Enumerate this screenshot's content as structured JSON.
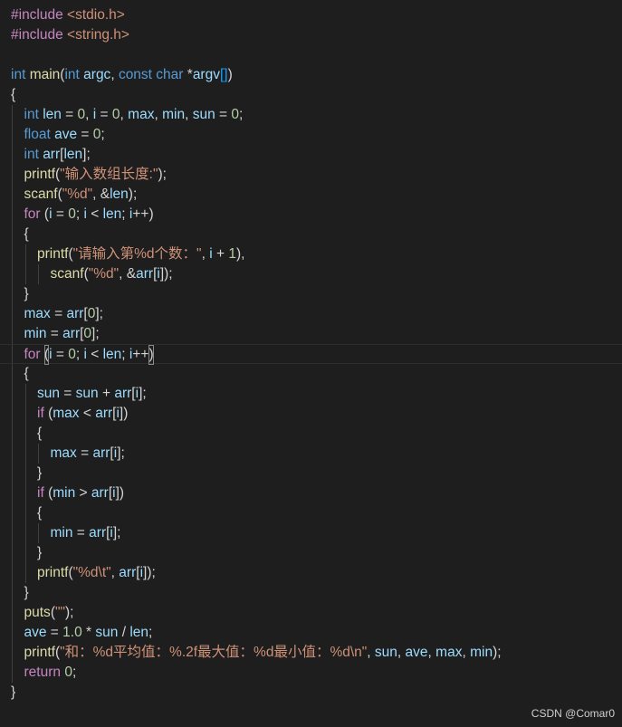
{
  "top_clip_text": "                  ... (",
  "watermark": "CSDN @Comar0",
  "colors": {
    "background": "#1e1e1e",
    "preprocessor": "#c586c0",
    "string": "#ce9178",
    "keyword": "#569cd6",
    "control": "#c586c0",
    "function": "#dcdcaa",
    "variable": "#9cdcfe",
    "number": "#b5cea8"
  },
  "lines": [
    {
      "indent": 0,
      "tokens": [
        [
          "pp",
          "#include "
        ],
        [
          "str",
          "<stdio.h>"
        ]
      ]
    },
    {
      "indent": 0,
      "tokens": [
        [
          "pp",
          "#include "
        ],
        [
          "str",
          "<string.h>"
        ]
      ]
    },
    {
      "indent": 0,
      "tokens": []
    },
    {
      "indent": 0,
      "tokens": [
        [
          "kw",
          "int "
        ],
        [
          "fn",
          "main"
        ],
        [
          "pun",
          "("
        ],
        [
          "kw",
          "int "
        ],
        [
          "var",
          "argc"
        ],
        [
          "pun",
          ", "
        ],
        [
          "kw",
          "const "
        ],
        [
          "kw",
          "char "
        ],
        [
          "pun",
          "*"
        ],
        [
          "var",
          "argv"
        ],
        [
          "brk3",
          "[]"
        ],
        [
          "pun",
          ")"
        ]
      ]
    },
    {
      "indent": 0,
      "tokens": [
        [
          "pun",
          "{"
        ]
      ]
    },
    {
      "indent": 1,
      "tokens": [
        [
          "kw",
          "int "
        ],
        [
          "var",
          "len"
        ],
        [
          "pun",
          " = "
        ],
        [
          "num",
          "0"
        ],
        [
          "pun",
          ", "
        ],
        [
          "var",
          "i"
        ],
        [
          "pun",
          " = "
        ],
        [
          "num",
          "0"
        ],
        [
          "pun",
          ", "
        ],
        [
          "var",
          "max"
        ],
        [
          "pun",
          ", "
        ],
        [
          "var",
          "min"
        ],
        [
          "pun",
          ", "
        ],
        [
          "var",
          "sun"
        ],
        [
          "pun",
          " = "
        ],
        [
          "num",
          "0"
        ],
        [
          "pun",
          ";"
        ]
      ]
    },
    {
      "indent": 1,
      "tokens": [
        [
          "kw",
          "float "
        ],
        [
          "var",
          "ave"
        ],
        [
          "pun",
          " = "
        ],
        [
          "num",
          "0"
        ],
        [
          "pun",
          ";"
        ]
      ]
    },
    {
      "indent": 1,
      "tokens": [
        [
          "kw",
          "int "
        ],
        [
          "var",
          "arr"
        ],
        [
          "pun",
          "["
        ],
        [
          "var",
          "len"
        ],
        [
          "pun",
          "];"
        ]
      ]
    },
    {
      "indent": 1,
      "tokens": [
        [
          "fn",
          "printf"
        ],
        [
          "pun",
          "("
        ],
        [
          "str",
          "\"输入数组长度:\""
        ],
        [
          "pun",
          ");"
        ]
      ]
    },
    {
      "indent": 1,
      "tokens": [
        [
          "fn",
          "scanf"
        ],
        [
          "pun",
          "("
        ],
        [
          "str",
          "\"%d\""
        ],
        [
          "pun",
          ", &"
        ],
        [
          "var",
          "len"
        ],
        [
          "pun",
          ");"
        ]
      ]
    },
    {
      "indent": 1,
      "tokens": [
        [
          "ctl",
          "for "
        ],
        [
          "pun",
          "("
        ],
        [
          "var",
          "i"
        ],
        [
          "pun",
          " = "
        ],
        [
          "num",
          "0"
        ],
        [
          "pun",
          "; "
        ],
        [
          "var",
          "i"
        ],
        [
          "pun",
          " < "
        ],
        [
          "var",
          "len"
        ],
        [
          "pun",
          "; "
        ],
        [
          "var",
          "i"
        ],
        [
          "pun",
          "++)"
        ]
      ]
    },
    {
      "indent": 1,
      "tokens": [
        [
          "pun",
          "{"
        ]
      ]
    },
    {
      "indent": 2,
      "tokens": [
        [
          "fn",
          "printf"
        ],
        [
          "pun",
          "("
        ],
        [
          "str",
          "\"请输入第%d个数：\""
        ],
        [
          "pun",
          ", "
        ],
        [
          "var",
          "i"
        ],
        [
          "pun",
          " + "
        ],
        [
          "num",
          "1"
        ],
        [
          "pun",
          "),"
        ]
      ]
    },
    {
      "indent": 3,
      "tokens": [
        [
          "fn",
          "scanf"
        ],
        [
          "pun",
          "("
        ],
        [
          "str",
          "\"%d\""
        ],
        [
          "pun",
          ", &"
        ],
        [
          "var",
          "arr"
        ],
        [
          "pun",
          "["
        ],
        [
          "var",
          "i"
        ],
        [
          "pun",
          "]);"
        ]
      ]
    },
    {
      "indent": 1,
      "tokens": [
        [
          "pun",
          "}"
        ]
      ]
    },
    {
      "indent": 1,
      "tokens": [
        [
          "var",
          "max"
        ],
        [
          "pun",
          " = "
        ],
        [
          "var",
          "arr"
        ],
        [
          "pun",
          "["
        ],
        [
          "num",
          "0"
        ],
        [
          "pun",
          "];"
        ]
      ]
    },
    {
      "indent": 1,
      "tokens": [
        [
          "var",
          "min"
        ],
        [
          "pun",
          " = "
        ],
        [
          "var",
          "arr"
        ],
        [
          "pun",
          "["
        ],
        [
          "num",
          "0"
        ],
        [
          "pun",
          "];"
        ]
      ]
    },
    {
      "indent": 1,
      "current": true,
      "tokens": [
        [
          "ctl",
          "for "
        ],
        [
          "pun",
          "("
        ],
        [
          "var",
          "i"
        ],
        [
          "pun",
          " = "
        ],
        [
          "num",
          "0"
        ],
        [
          "pun",
          "; "
        ],
        [
          "var",
          "i"
        ],
        [
          "pun",
          " < "
        ],
        [
          "var",
          "len"
        ],
        [
          "pun",
          "; "
        ],
        [
          "var",
          "i"
        ],
        [
          "pun",
          "++"
        ],
        [
          "pun",
          ")"
        ]
      ]
    },
    {
      "indent": 1,
      "tokens": [
        [
          "pun",
          "{"
        ]
      ]
    },
    {
      "indent": 2,
      "tokens": [
        [
          "var",
          "sun"
        ],
        [
          "pun",
          " = "
        ],
        [
          "var",
          "sun"
        ],
        [
          "pun",
          " + "
        ],
        [
          "var",
          "arr"
        ],
        [
          "pun",
          "["
        ],
        [
          "var",
          "i"
        ],
        [
          "pun",
          "];"
        ]
      ]
    },
    {
      "indent": 2,
      "tokens": [
        [
          "ctl",
          "if "
        ],
        [
          "pun",
          "("
        ],
        [
          "var",
          "max"
        ],
        [
          "pun",
          " < "
        ],
        [
          "var",
          "arr"
        ],
        [
          "pun",
          "["
        ],
        [
          "var",
          "i"
        ],
        [
          "pun",
          "])"
        ]
      ]
    },
    {
      "indent": 2,
      "tokens": [
        [
          "pun",
          "{"
        ]
      ]
    },
    {
      "indent": 3,
      "tokens": [
        [
          "var",
          "max"
        ],
        [
          "pun",
          " = "
        ],
        [
          "var",
          "arr"
        ],
        [
          "pun",
          "["
        ],
        [
          "var",
          "i"
        ],
        [
          "pun",
          "];"
        ]
      ]
    },
    {
      "indent": 2,
      "tokens": [
        [
          "pun",
          "}"
        ]
      ]
    },
    {
      "indent": 2,
      "tokens": [
        [
          "ctl",
          "if "
        ],
        [
          "pun",
          "("
        ],
        [
          "var",
          "min"
        ],
        [
          "pun",
          " > "
        ],
        [
          "var",
          "arr"
        ],
        [
          "pun",
          "["
        ],
        [
          "var",
          "i"
        ],
        [
          "pun",
          "])"
        ]
      ]
    },
    {
      "indent": 2,
      "tokens": [
        [
          "pun",
          "{"
        ]
      ]
    },
    {
      "indent": 3,
      "tokens": [
        [
          "var",
          "min"
        ],
        [
          "pun",
          " = "
        ],
        [
          "var",
          "arr"
        ],
        [
          "pun",
          "["
        ],
        [
          "var",
          "i"
        ],
        [
          "pun",
          "];"
        ]
      ]
    },
    {
      "indent": 2,
      "tokens": [
        [
          "pun",
          "}"
        ]
      ]
    },
    {
      "indent": 2,
      "tokens": [
        [
          "fn",
          "printf"
        ],
        [
          "pun",
          "("
        ],
        [
          "str",
          "\"%d\\t\""
        ],
        [
          "pun",
          ", "
        ],
        [
          "var",
          "arr"
        ],
        [
          "pun",
          "["
        ],
        [
          "var",
          "i"
        ],
        [
          "pun",
          "]);"
        ]
      ]
    },
    {
      "indent": 1,
      "tokens": [
        [
          "pun",
          "}"
        ]
      ]
    },
    {
      "indent": 1,
      "tokens": [
        [
          "fn",
          "puts"
        ],
        [
          "pun",
          "("
        ],
        [
          "str",
          "\"\""
        ],
        [
          "pun",
          ");"
        ]
      ]
    },
    {
      "indent": 1,
      "tokens": [
        [
          "var",
          "ave"
        ],
        [
          "pun",
          " = "
        ],
        [
          "num",
          "1.0"
        ],
        [
          "pun",
          " * "
        ],
        [
          "var",
          "sun"
        ],
        [
          "pun",
          " / "
        ],
        [
          "var",
          "len"
        ],
        [
          "pun",
          ";"
        ]
      ]
    },
    {
      "indent": 1,
      "tokens": [
        [
          "fn",
          "printf"
        ],
        [
          "pun",
          "("
        ],
        [
          "str",
          "\"和：%d平均值：%.2f最大值：%d最小值：%d\\n\""
        ],
        [
          "pun",
          ", "
        ],
        [
          "var",
          "sun"
        ],
        [
          "pun",
          ", "
        ],
        [
          "var",
          "ave"
        ],
        [
          "pun",
          ", "
        ],
        [
          "var",
          "max"
        ],
        [
          "pun",
          ", "
        ],
        [
          "var",
          "min"
        ],
        [
          "pun",
          ");"
        ]
      ]
    },
    {
      "indent": 1,
      "tokens": [
        [
          "ctl",
          "return "
        ],
        [
          "num",
          "0"
        ],
        [
          "pun",
          ";"
        ]
      ]
    },
    {
      "indent": 0,
      "tokens": [
        [
          "pun",
          "}"
        ]
      ]
    }
  ]
}
